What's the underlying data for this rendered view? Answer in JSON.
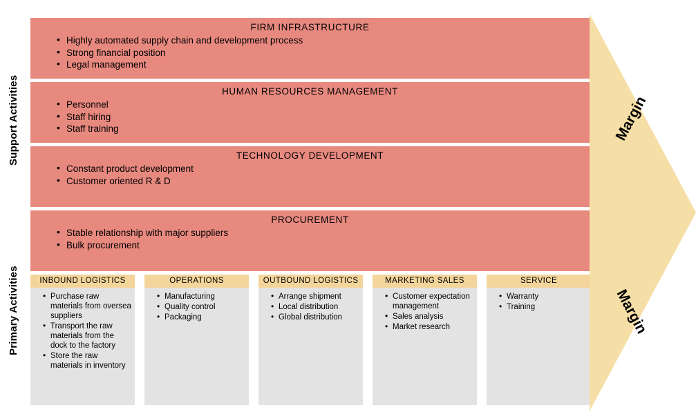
{
  "side_labels": {
    "support": "Support Activities",
    "primary": "Primary Activities"
  },
  "margin": {
    "top": "Margin",
    "bottom": "Margin",
    "color": "#f6dfa6"
  },
  "colors": {
    "support_band": "#e8897f",
    "primary_header": "#f3d59b",
    "primary_body": "#e3e3e3"
  },
  "support_activities": [
    {
      "title": "FIRM INFRASTRUCTURE",
      "items": [
        "Highly automated supply chain and development process",
        "Strong financial position",
        "Legal management"
      ]
    },
    {
      "title": "HUMAN RESOURCES MANAGEMENT",
      "items": [
        "Personnel",
        "Staff hiring",
        "Staff training"
      ]
    },
    {
      "title": "TECHNOLOGY DEVELOPMENT",
      "items": [
        "Constant product development",
        "Customer oriented R & D"
      ]
    },
    {
      "title": "PROCUREMENT",
      "items": [
        "Stable relationship with major suppliers",
        "Bulk procurement"
      ]
    }
  ],
  "primary_activities": [
    {
      "title": "INBOUND LOGISTICS",
      "items": [
        "Purchase raw materials from oversea suppliers",
        "Transport the raw materials from the dock to the factory",
        "Store the raw materials in inventory"
      ]
    },
    {
      "title": "OPERATIONS",
      "items": [
        "Manufacturing",
        "Quality control",
        "Packaging"
      ]
    },
    {
      "title": "OUTBOUND LOGISTICS",
      "items": [
        "Arrange shipment",
        "Local distribution",
        "Global distribution"
      ]
    },
    {
      "title": "MARKETING SALES",
      "items": [
        "Customer expectation management",
        "Sales analysis",
        "Market research"
      ]
    },
    {
      "title": "SERVICE",
      "items": [
        "Warranty",
        "Training"
      ]
    }
  ]
}
